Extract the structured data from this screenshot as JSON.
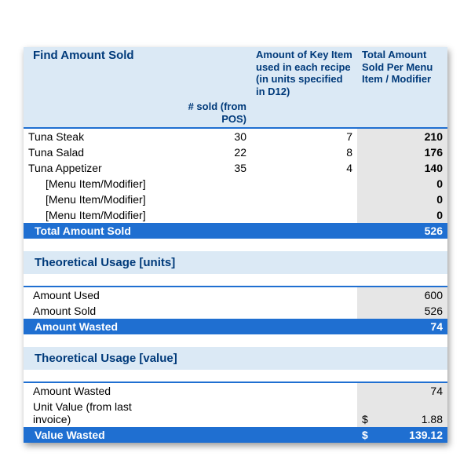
{
  "headers": {
    "title": "Find Amount Sold",
    "col_sold": "# sold (from POS)",
    "col_keyitem": "Amount of Key Item used in each recipe (in units specified in D12)",
    "col_total": "Total Amount Sold Per Menu Item / Modifier"
  },
  "rows": [
    {
      "name": "Tuna Steak",
      "sold": "30",
      "key": "7",
      "total": "210",
      "ph": false
    },
    {
      "name": "Tuna Salad",
      "sold": "22",
      "key": "8",
      "total": "176",
      "ph": false
    },
    {
      "name": "Tuna Appetizer",
      "sold": "35",
      "key": "4",
      "total": "140",
      "ph": false
    },
    {
      "name": "[Menu Item/Modifier]",
      "sold": "",
      "key": "",
      "total": "0",
      "ph": true
    },
    {
      "name": "[Menu Item/Modifier]",
      "sold": "",
      "key": "",
      "total": "0",
      "ph": true
    },
    {
      "name": "[Menu Item/Modifier]",
      "sold": "",
      "key": "",
      "total": "0",
      "ph": true
    }
  ],
  "totals": {
    "total_amount_sold_label": "Total Amount Sold",
    "total_amount_sold_value": "526"
  },
  "theoretical_units": {
    "section": "Theoretical Usage [units]",
    "amount_used_label": "Amount Used",
    "amount_used_value": "600",
    "amount_sold_label": "Amount Sold",
    "amount_sold_value": "526",
    "amount_wasted_label": "Amount Wasted",
    "amount_wasted_value": "74"
  },
  "theoretical_value": {
    "section": "Theoretical Usage [value]",
    "amount_wasted_label": "Amount Wasted",
    "amount_wasted_value": "74",
    "unit_value_label": "Unit Value (from last invoice)",
    "unit_value_currency": "$",
    "unit_value_value": "1.88",
    "value_wasted_label": "Value Wasted",
    "value_wasted_currency": "$",
    "value_wasted_value": "139.12"
  }
}
